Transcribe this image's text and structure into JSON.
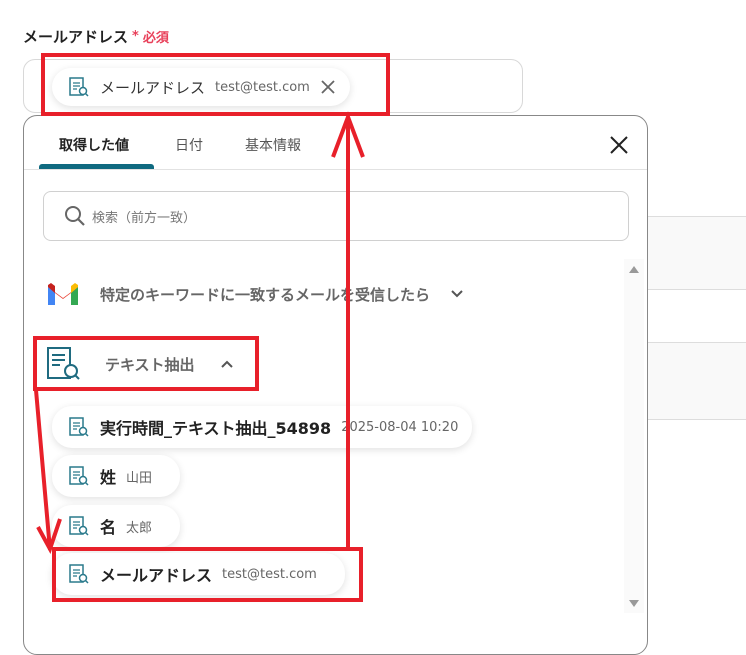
{
  "field": {
    "label": "メールアドレス",
    "required_mark": "*",
    "required_text": "必須",
    "chip": {
      "key": "メールアドレス",
      "value": "test@test.com"
    }
  },
  "panel": {
    "tabs": [
      {
        "label": "取得した値",
        "active": true
      },
      {
        "label": "日付"
      },
      {
        "label": "基本情報"
      }
    ],
    "search_placeholder": "検索（前方一致）",
    "groups": [
      {
        "label": "特定のキーワードに一致するメールを受信したら",
        "icon": "gmail-icon",
        "expanded": false
      },
      {
        "label": "テキスト抽出",
        "icon": "text-extract-icon",
        "expanded": true,
        "items": [
          {
            "key": "実行時間_テキスト抽出_54898",
            "value": "2025-08-04 10:20"
          },
          {
            "key": "姓",
            "value": "山田"
          },
          {
            "key": "名",
            "value": "太郎"
          },
          {
            "key": "メールアドレス",
            "value": "test@test.com"
          }
        ]
      }
    ]
  },
  "colors": {
    "accent": "#0f6a80",
    "required": "#e8405a",
    "annotation": "#e8202a"
  }
}
